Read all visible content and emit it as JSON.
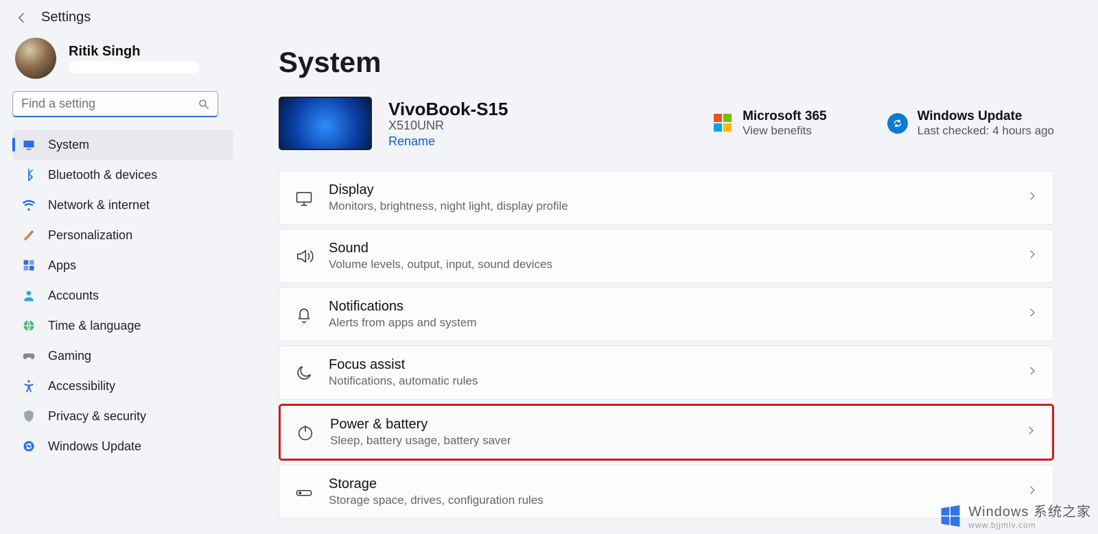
{
  "header": {
    "title": "Settings"
  },
  "user": {
    "name": "Ritik Singh"
  },
  "search": {
    "placeholder": "Find a setting"
  },
  "nav": {
    "items": [
      {
        "id": "system",
        "label": "System",
        "active": true
      },
      {
        "id": "bluetooth",
        "label": "Bluetooth & devices"
      },
      {
        "id": "network",
        "label": "Network & internet"
      },
      {
        "id": "personalization",
        "label": "Personalization"
      },
      {
        "id": "apps",
        "label": "Apps"
      },
      {
        "id": "accounts",
        "label": "Accounts"
      },
      {
        "id": "time",
        "label": "Time & language"
      },
      {
        "id": "gaming",
        "label": "Gaming"
      },
      {
        "id": "accessibility",
        "label": "Accessibility"
      },
      {
        "id": "privacy",
        "label": "Privacy & security"
      },
      {
        "id": "update",
        "label": "Windows Update"
      }
    ]
  },
  "page": {
    "title": "System"
  },
  "device": {
    "name": "VivoBook-S15",
    "model": "X510UNR",
    "rename": "Rename"
  },
  "promos": {
    "ms365": {
      "title": "Microsoft 365",
      "sub": "View benefits"
    },
    "update": {
      "title": "Windows Update",
      "sub": "Last checked: 4 hours ago"
    }
  },
  "cards": [
    {
      "id": "display",
      "title": "Display",
      "sub": "Monitors, brightness, night light, display profile"
    },
    {
      "id": "sound",
      "title": "Sound",
      "sub": "Volume levels, output, input, sound devices"
    },
    {
      "id": "notifications",
      "title": "Notifications",
      "sub": "Alerts from apps and system"
    },
    {
      "id": "focus",
      "title": "Focus assist",
      "sub": "Notifications, automatic rules"
    },
    {
      "id": "power",
      "title": "Power & battery",
      "sub": "Sleep, battery usage, battery saver",
      "highlight": true
    },
    {
      "id": "storage",
      "title": "Storage",
      "sub": "Storage space, drives, configuration rules"
    }
  ],
  "watermark": {
    "brand_cn": "Windows",
    "brand_suffix": " 系统之家",
    "url": "www.bjjmlv.com"
  }
}
